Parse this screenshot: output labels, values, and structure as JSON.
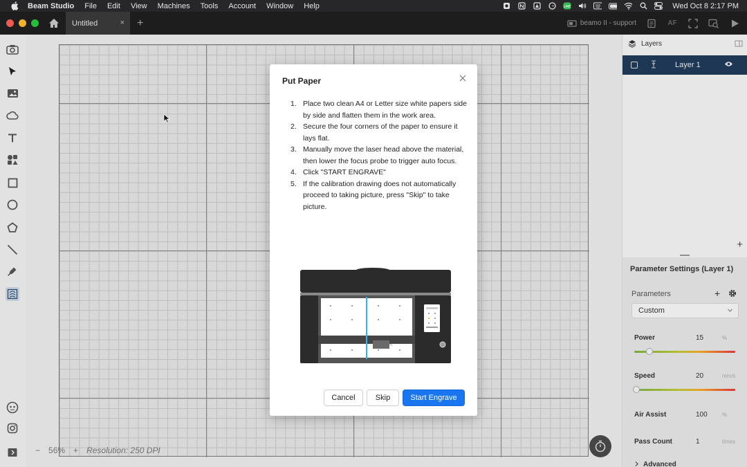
{
  "menubar": {
    "app_name": "Beam Studio",
    "items": [
      "File",
      "Edit",
      "View",
      "Machines",
      "Tools",
      "Account",
      "Window",
      "Help"
    ],
    "clock": "Wed Oct 8  2:17 PM"
  },
  "tabbar": {
    "tab_title": "Untitled",
    "tab_close": "×",
    "new_tab": "+",
    "machine_name": "beamo II - support",
    "af_label": "AF"
  },
  "canvas": {
    "zoom_minus": "−",
    "zoom_level": "56%",
    "zoom_plus": "+",
    "resolution": "Resolution: 250 DPI"
  },
  "layers_panel": {
    "title": "Layers",
    "layer_name": "Layer 1",
    "add_label": "+"
  },
  "parameters": {
    "title": "Parameter Settings (Layer 1)",
    "section_label": "Parameters",
    "preset": "Custom",
    "power_label": "Power",
    "power_value": "15",
    "power_unit": "%",
    "power_fraction": 0.15,
    "speed_label": "Speed",
    "speed_value": "20",
    "speed_unit": "mm/s",
    "speed_fraction": 0.02,
    "air_assist_label": "Air Assist",
    "air_assist_value": "100",
    "air_assist_unit": "%",
    "pass_count_label": "Pass Count",
    "pass_count_value": "1",
    "pass_count_unit": "times",
    "advanced_label": "Advanced"
  },
  "dialog": {
    "title": "Put Paper",
    "steps": [
      "Place two clean A4 or Letter size white papers side by side and flatten them in the work area.",
      "Secure the four corners of the paper to ensure it lays flat.",
      "Manually move the laser head above the material, then lower the focus probe to trigger auto focus.",
      "Click \"START ENGRAVE\"",
      "If the calibration drawing does not automatically proceed to taking picture, press \"Skip\" to take picture."
    ],
    "cancel_label": "Cancel",
    "skip_label": "Skip",
    "start_label": "Start Engrave"
  },
  "colors": {
    "accent": "#1976f0",
    "layer_row": "#1f3a5a",
    "guide_line": "#29b6f6"
  }
}
